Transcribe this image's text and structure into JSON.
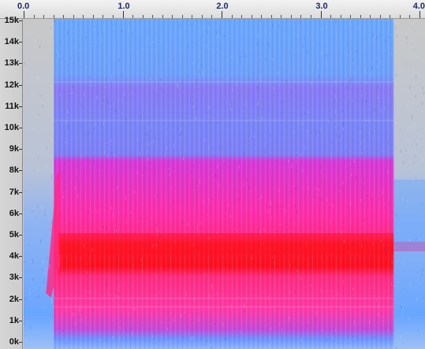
{
  "time_ruler": {
    "labels": [
      "0.0",
      "1.0",
      "2.0",
      "3.0",
      "4.0"
    ]
  },
  "frequency_axis": {
    "labels": [
      "15k",
      "14k",
      "13k",
      "12k",
      "11k",
      "10k",
      "9k",
      "8k",
      "7k",
      "6k",
      "5k",
      "4k",
      "3k",
      "2k",
      "1k",
      "0k"
    ]
  },
  "spectrogram": {
    "audio_start_seconds": 0.25,
    "audio_end_seconds": 3.7,
    "strong_band_khz": [
      4.0,
      5.0
    ],
    "energy_band_khz": [
      0.8,
      8.6
    ],
    "colors": {
      "background": "#c4c4c4",
      "quiet": "#66a7ff",
      "mid": "#7a6cf0",
      "loud": "#ff2c86",
      "peak": "#ff1020"
    }
  }
}
